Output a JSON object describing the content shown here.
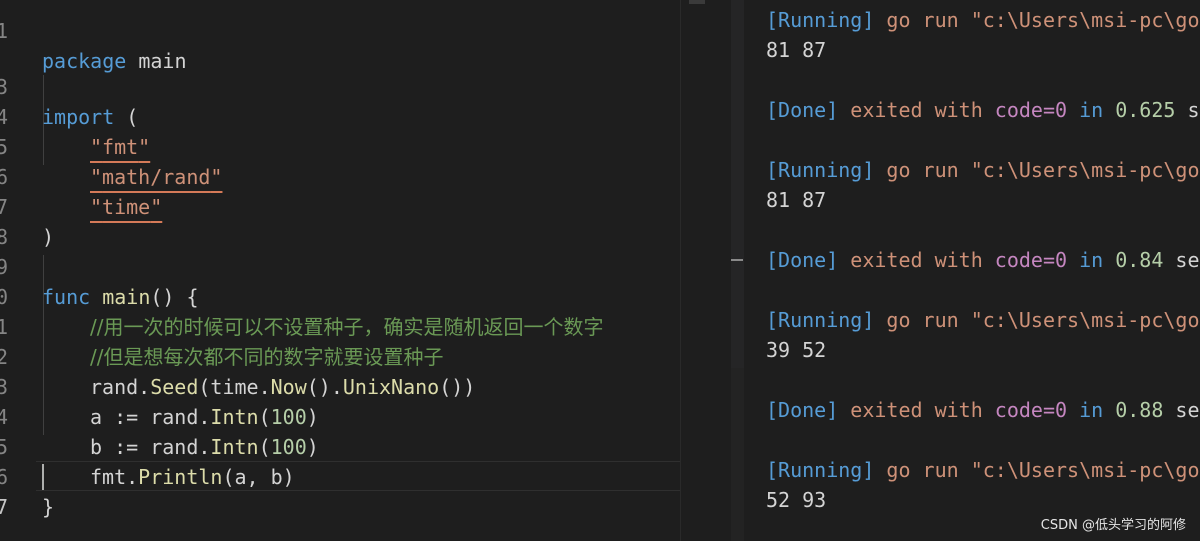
{
  "editor": {
    "line_numbers": [
      "1",
      "3",
      "4",
      "5",
      "6",
      "7",
      "8",
      "9",
      "0",
      "1",
      "2",
      "3",
      "4",
      "5",
      "6",
      "7"
    ],
    "lines": {
      "l1_kw": "package",
      "l1_id": " main",
      "l3_kw": "import",
      "l3_paren": " (",
      "l4_q1": "\"",
      "l4_str": "fmt",
      "l4_q2": "\"",
      "l5_q1": "\"",
      "l5_str": "math/rand",
      "l5_q2": "\"",
      "l6_q1": "\"",
      "l6_str": "time",
      "l6_q2": "\"",
      "l7": ")",
      "l9_kw": "func",
      "l9_fn": "main",
      "l9_rest": "() {",
      "l10_cmt": "//用一次的时候可以不设置种子，确实是随机返回一个数字",
      "l11_cmt": "//但是想每次都不同的数字就要设置种子",
      "l12_a": "rand.",
      "l12_fn1": "Seed",
      "l12_b": "(time.",
      "l12_fn2": "Now",
      "l12_c": "().",
      "l12_fn3": "UnixNano",
      "l12_d": "())",
      "l13_a": "a := rand.",
      "l13_fn": "Intn",
      "l13_b": "(",
      "l13_num": "100",
      "l13_c": ")",
      "l14_a": "b := rand.",
      "l14_fn": "Intn",
      "l14_b": "(",
      "l14_num": "100",
      "l14_c": ")",
      "l15_a": "fmt.",
      "l15_fn": "Println",
      "l15_b": "(a, b)",
      "l16": "}"
    }
  },
  "output": {
    "running_tag": "[Running]",
    "running_cmd": " go run \"c:\\Users\\msi-pc\\go",
    "done_tag": "[Done]",
    "done_text": " exited with ",
    "code_text": "code=0",
    "in_text": " in ",
    "runs": [
      {
        "result": "81 87",
        "time": "0.625",
        "suffix": " s"
      },
      {
        "result": "81 87",
        "time": "0.84",
        "suffix": " se"
      },
      {
        "result": "39 52",
        "time": "0.88",
        "suffix": " se"
      },
      {
        "result": "52 93"
      }
    ]
  },
  "watermark": "CSDN @低头学习的阿修",
  "colors": {
    "background": "#1e1e1e",
    "keyword": "#569cd6",
    "function": "#dcdcaa",
    "string": "#ce9178",
    "number": "#b5cea8",
    "comment": "#6a9955",
    "code_keyword": "#c586c0"
  }
}
